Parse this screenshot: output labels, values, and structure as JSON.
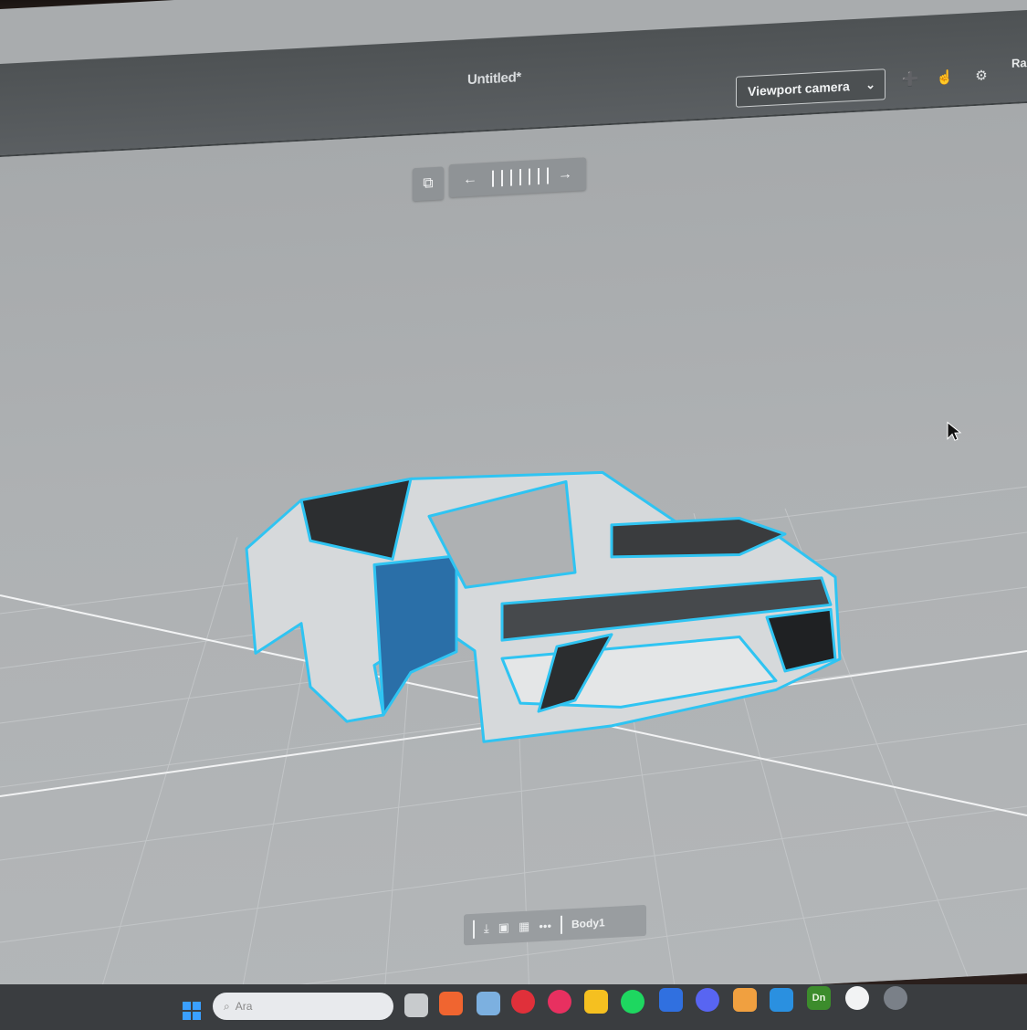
{
  "window": {
    "title": "Untitled*"
  },
  "camera": {
    "select_value": "Viewport camera",
    "buttons": [
      "add-camera-icon",
      "camera-from-view-icon",
      "camera-settings-icon"
    ],
    "extra_label": "Ra"
  },
  "viewport_toolbar": {
    "items": [
      "view-cube-icon",
      "arrow-left-icon",
      "timeline-track",
      "arrow-right-icon"
    ]
  },
  "model": {
    "name": "Body1",
    "highlight_color": "#2fc4f2"
  },
  "bottom_toolbar": {
    "items": [
      "import-icon",
      "layers-icon",
      "appearance-icon",
      "more-icon"
    ],
    "label": "Body1"
  },
  "taskbar": {
    "search_placeholder": "Ara",
    "apps": [
      "start-icon",
      "explorer-icon",
      "git-icon",
      "photos-icon",
      "browser-red-icon",
      "opera-icon",
      "files-icon",
      "spotify-icon",
      "network-icon",
      "discord-icon",
      "gallery-icon",
      "monitor-icon",
      "dimension-icon",
      "app-icon",
      "settings-icon"
    ],
    "active_app_label": "Dn"
  },
  "colors": {
    "viewport_bg": "#aeb1b3",
    "accent": "#2fc4f2",
    "titlebar": "#565a5c"
  }
}
